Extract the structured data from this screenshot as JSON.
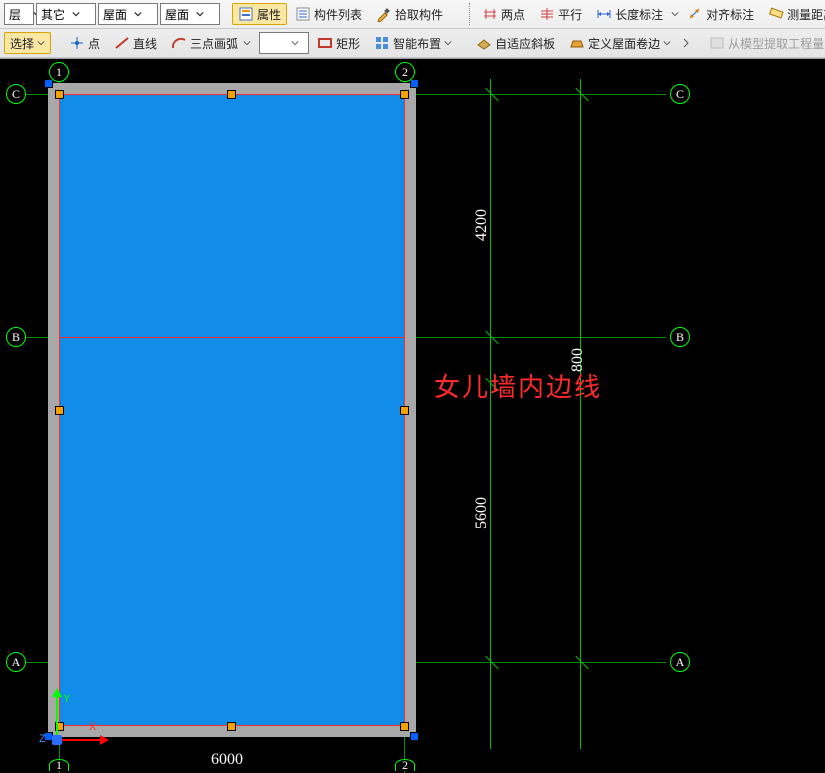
{
  "toolbar": {
    "row1": {
      "dd1": "层",
      "dd2": "其它",
      "dd3": "屋面",
      "dd4": "屋面",
      "props_btn": "属性",
      "list_btn": "构件列表",
      "pick_btn": "拾取构件",
      "two_point": "两点",
      "parallel": "平行",
      "length_dim": "长度标注",
      "align_dim": "对齐标注",
      "measure": "测量距离"
    },
    "row2": {
      "select": "选择",
      "point": "点",
      "line": "直线",
      "arc3p": "三点画弧",
      "rect": "矩形",
      "smart_layout": "智能布置",
      "adapt_slab": "自适应斜板",
      "def_roof_edge": "定义屋面卷边",
      "extract_qty": "从模型提取工程量"
    }
  },
  "drawing": {
    "grid_labels": {
      "c": "C",
      "b": "B",
      "a": "A",
      "n1": "1",
      "n2": "2"
    },
    "dims": {
      "w": "6000",
      "h1": "4200",
      "h_mid": "800",
      "h2": "5600"
    },
    "annotation": "女儿墙内边线",
    "axes": {
      "x": "X",
      "y": "Y",
      "z": "Z"
    }
  }
}
